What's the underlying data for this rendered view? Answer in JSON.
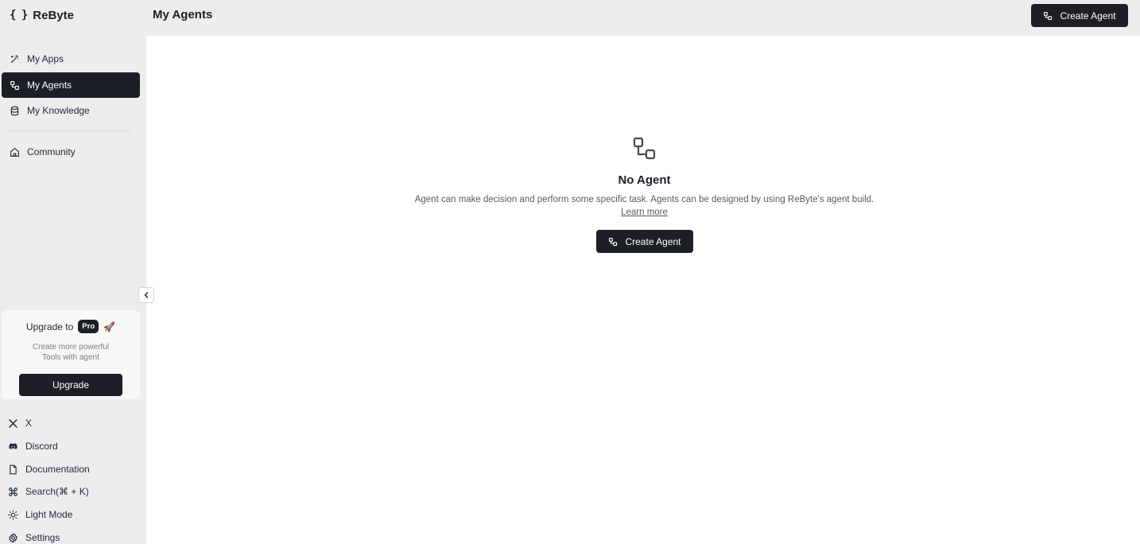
{
  "app": {
    "logo_mark": "{ }",
    "name": "ReByte"
  },
  "sidebar": {
    "nav": [
      {
        "label": "My Apps",
        "icon": "wand-icon",
        "active": false
      },
      {
        "label": "My Agents",
        "icon": "workflow-icon",
        "active": true
      },
      {
        "label": "My Knowledge",
        "icon": "database-icon",
        "active": false
      },
      {
        "label": "Community",
        "icon": "home-icon",
        "active": false
      }
    ],
    "upgrade": {
      "prefix": "Upgrade to",
      "badge": "Pro",
      "emoji": "🚀",
      "line1": "Create more powerful",
      "line2": "Tools with agent",
      "button": "Upgrade"
    },
    "bottom": [
      {
        "label": "X",
        "icon": "x-logo-icon"
      },
      {
        "label": "Discord",
        "icon": "discord-icon"
      },
      {
        "label": "Documentation",
        "icon": "document-icon"
      },
      {
        "label": "Search(⌘ + K)",
        "icon": "command-icon"
      },
      {
        "label": "Light Mode",
        "icon": "sun-icon"
      },
      {
        "label": "Settings",
        "icon": "gear-icon"
      }
    ]
  },
  "header": {
    "title": "My Agents",
    "create_button": "Create Agent"
  },
  "empty_state": {
    "title": "No Agent",
    "description": "Agent can make decision and perform some specific task. Agents can be designed by using ReByte's agent build.",
    "link": "Learn more",
    "button": "Create Agent"
  },
  "colors": {
    "accent": "#1c1f26",
    "background": "#ededed",
    "panel": "#ffffff"
  }
}
